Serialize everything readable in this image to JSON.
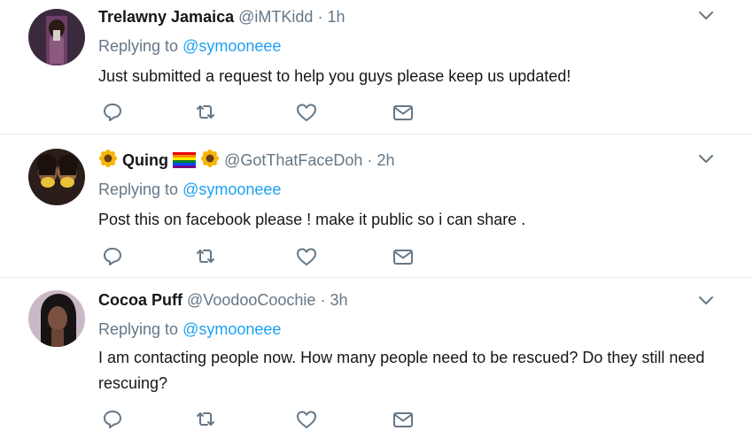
{
  "tweets": [
    {
      "name": "Trelawny Jamaica",
      "handle": "@iMTKidd",
      "time": "1h",
      "replying_prefix": "Replying to ",
      "replying_to": "@symooneee",
      "text": "Just submitted a request to help you guys please keep us updated!"
    },
    {
      "name_prefix_icon": "sunflower-emoji",
      "name": "Quing",
      "name_icons": [
        "rainbow-flag-emoji",
        "sunflower-emoji"
      ],
      "handle": "@GotThatFaceDoh",
      "time": "2h",
      "replying_prefix": "Replying to ",
      "replying_to": "@symooneee",
      "text": "Post this on facebook please ! make it public so i can share ."
    },
    {
      "name": "Cocoa Puff",
      "handle": "@VoodooCoochie",
      "time": "3h",
      "replying_prefix": "Replying to ",
      "replying_to": "@symooneee",
      "text": "I am contacting people now. How many people need to be rescued? Do they still need rescuing?"
    }
  ],
  "separator": "·",
  "actions": [
    "reply-icon",
    "retweet-icon",
    "like-icon",
    "direct-message-icon"
  ],
  "colors": {
    "link": "#1da1f2",
    "secondary": "#657786",
    "primary": "#14171a",
    "divider": "#e6ecf0"
  }
}
